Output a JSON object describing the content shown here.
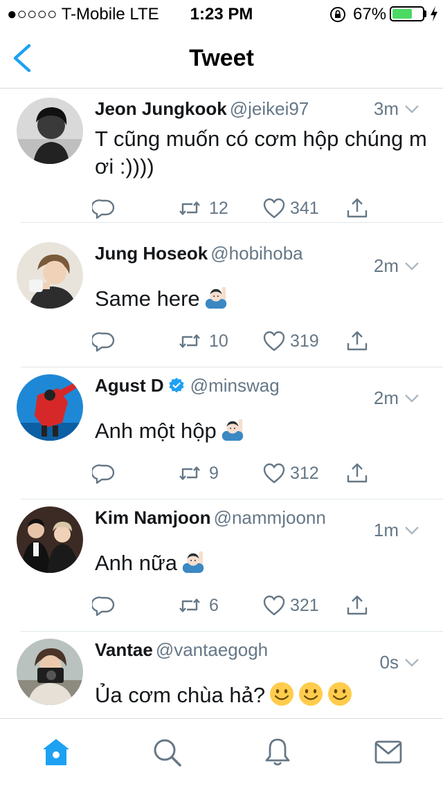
{
  "status_bar": {
    "carrier": "●○○○○ T-Mobile  LTE",
    "time": "1:23 PM",
    "battery": "67%",
    "battery_level": 0.67
  },
  "nav": {
    "title": "Tweet"
  },
  "tweets": [
    {
      "name": "Jeon Jungkook",
      "handle": "@jeikei97",
      "time": "3m",
      "text": "T cũng muốn có cơm hộp chúng m ơi :))))",
      "retweets": "12",
      "likes": "341"
    },
    {
      "name": "Jung Hoseok",
      "handle": "@hobihoba",
      "time": "2m",
      "text": "Same here",
      "retweets": "10",
      "likes": "319"
    },
    {
      "name": "Agust D",
      "handle": "@minswag",
      "time": "2m",
      "text": "Anh một hộp",
      "retweets": "9",
      "likes": "312",
      "verified": true
    },
    {
      "name": "Kim Namjoon",
      "handle": "@nammjoonn",
      "time": "1m",
      "text": "Anh nữa",
      "retweets": "6",
      "likes": "321"
    },
    {
      "name": "Vantae",
      "handle": "@vantaegogh",
      "time": "0s",
      "text": "Ủa cơm chùa hả?"
    }
  ],
  "colors": {
    "accent": "#1da1f2",
    "secondary_text": "#657786",
    "battery": "#4cd964"
  },
  "icons": [
    "back-chevron-icon",
    "caret-down-icon",
    "reply-icon",
    "retweet-icon",
    "like-icon",
    "share-icon",
    "raising-hand-emoji",
    "smiley-emoji",
    "home-icon",
    "search-icon",
    "notifications-icon",
    "messages-icon"
  ]
}
